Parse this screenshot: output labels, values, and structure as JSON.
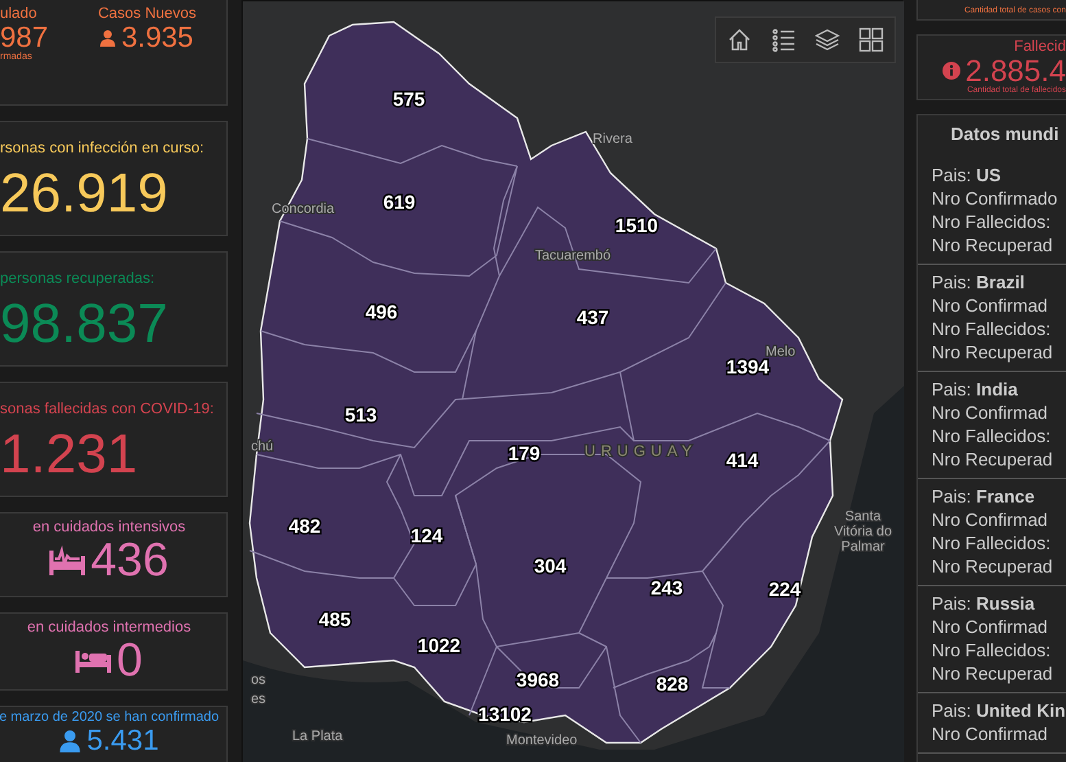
{
  "left_panel": {
    "cards": [
      {
        "kind": "split",
        "title": "ulado",
        "value": "987",
        "caption": "rmadas",
        "side_title": "Casos Nuevos",
        "side_value": "3.935",
        "color": "#f07140"
      },
      {
        "kind": "big",
        "title": "rsonas con infección en curso:",
        "value": "26.919",
        "color": "#f7c95a"
      },
      {
        "kind": "big",
        "title": "personas recuperadas:",
        "value": "98.837",
        "color": "#0b8a56"
      },
      {
        "kind": "big",
        "title": "sonas fallecidas con COVID-19:",
        "value": "1.231",
        "color": "#d3434f"
      },
      {
        "kind": "bed-pulse",
        "title": "en cuidados intensivos",
        "value": "436",
        "color": "#e072b0"
      },
      {
        "kind": "bed",
        "title": "en cuidados intermedios",
        "value": "0",
        "color": "#e072b0"
      },
      {
        "kind": "person",
        "title": "e marzo de 2020 se han confirmado",
        "value": "5.431",
        "color": "#3a9bf0"
      }
    ]
  },
  "map": {
    "counts": [
      "575",
      "619",
      "1510",
      "496",
      "437",
      "1394",
      "513",
      "179",
      "414",
      "482",
      "124",
      "304",
      "243",
      "224",
      "485",
      "1022",
      "3968",
      "828",
      "13102"
    ],
    "places": [
      {
        "lines": [
          "Concordia"
        ]
      },
      {
        "lines": [
          "Rivera"
        ]
      },
      {
        "lines": [
          "Tacuarembó"
        ]
      },
      {
        "lines": [
          "Melo"
        ]
      },
      {
        "lines": [
          "URUGUAY"
        ],
        "kind": "country"
      },
      {
        "lines": [
          "chú"
        ]
      },
      {
        "lines": [
          "Santa",
          "Vitória do",
          "Palmar"
        ]
      },
      {
        "lines": [
          "os"
        ]
      },
      {
        "lines": [
          "es"
        ]
      },
      {
        "lines": [
          "La Plata"
        ]
      },
      {
        "lines": [
          "Montevideo"
        ]
      }
    ]
  },
  "right_panel": {
    "cards": [
      {
        "kind": "caption",
        "caption": "Cantidad total de casos con",
        "color": "#f07140"
      },
      {
        "kind": "stat",
        "title": "Fallecid",
        "value": "2.885.4",
        "caption": "Cantidad total de fallecidos",
        "color": "#d3434f"
      }
    ],
    "world": {
      "title": "Datos mundi",
      "countries": [
        {
          "country": "Pais: **US**",
          "lines": [
            "Nro Confirmado",
            "Nro Fallecidos:",
            "Nro Recuperad"
          ]
        },
        {
          "country": "Pais: **Brazil**",
          "lines": [
            "Nro Confirmad",
            "Nro Fallecidos:",
            "Nro Recuperad"
          ]
        },
        {
          "country": "Pais: **India**",
          "lines": [
            "Nro Confirmad",
            "Nro Fallecidos:",
            "Nro Recuperad"
          ]
        },
        {
          "country": "Pais: **France**",
          "lines": [
            "Nro Confirmad",
            "Nro Fallecidos:",
            "Nro Recuperad"
          ]
        },
        {
          "country": "Pais: **Russia**",
          "lines": [
            "Nro Confirmad",
            "Nro Fallecidos:",
            "Nro Recuperad"
          ]
        },
        {
          "country": "Pais: **United Kin**",
          "lines": [
            "Nro Confirmad"
          ]
        }
      ]
    }
  }
}
